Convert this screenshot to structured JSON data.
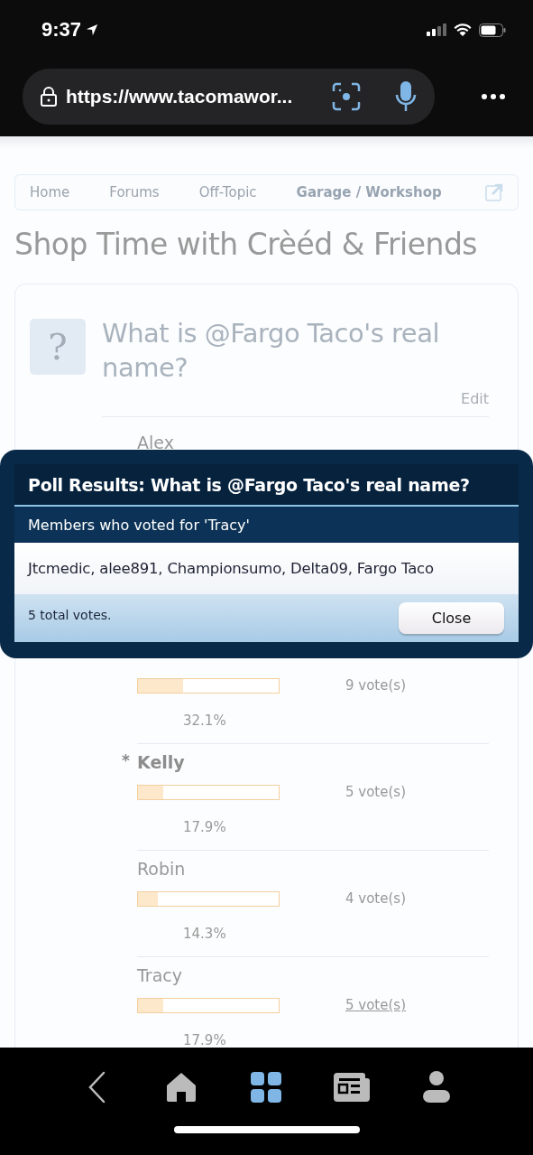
{
  "status_bar": {
    "time": "9:37"
  },
  "browser": {
    "url": "https://www.tacomawor..."
  },
  "breadcrumbs": [
    {
      "label": "Home",
      "current": false
    },
    {
      "label": "Forums",
      "current": false
    },
    {
      "label": "Off-Topic",
      "current": false
    },
    {
      "label": "Garage / Workshop",
      "current": true
    }
  ],
  "thread_title": "Shop Time with Crèéd & Friends",
  "poll": {
    "icon": "?",
    "question": "What is @Fargo Taco's real name?",
    "edit": "Edit",
    "options": [
      {
        "name": "Alex"
      },
      {
        "level": 0.321,
        "votes": "9 vote(s)",
        "percent": "32.1%",
        "selected": false
      },
      {
        "name": "Kelly",
        "level": 0.179,
        "votes": "5 vote(s)",
        "percent": "17.9%",
        "voted": true,
        "marker": "*",
        "selected": false
      },
      {
        "name": "Robin",
        "level": 0.143,
        "votes": "4 vote(s)",
        "percent": "14.3%",
        "voted": false,
        "selected": false
      },
      {
        "name": "Tracy",
        "level": 0.179,
        "votes": "5 vote(s)",
        "percent": "17.9%",
        "voted": false,
        "selected": true
      }
    ]
  },
  "overlay": {
    "title": "Poll Results: What is @Fargo Taco's real name?",
    "subtitle": "Members who voted for 'Tracy'",
    "members": "Jtcmedic, alee891, Championsumo, Delta09, Fargo Taco",
    "total": "5 total votes.",
    "close": "Close"
  },
  "bottom_nav": [
    {
      "kind": "back",
      "selected": false
    },
    {
      "kind": "home",
      "selected": false
    },
    {
      "kind": "grid",
      "selected": true
    },
    {
      "kind": "news",
      "selected": false
    },
    {
      "kind": "person",
      "selected": false
    }
  ]
}
